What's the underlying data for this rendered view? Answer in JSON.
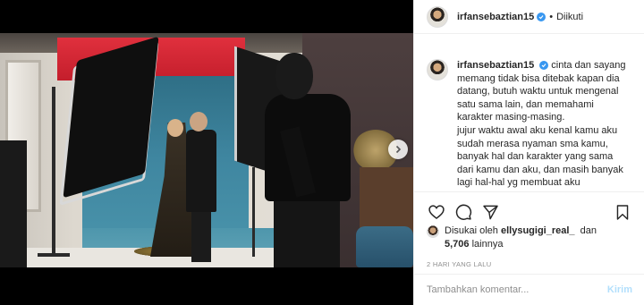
{
  "header": {
    "username": "irfansebaztian15",
    "separator": "•",
    "follow_status": "Diikuti"
  },
  "caption": {
    "username": "irfansebaztian15",
    "lines": [
      "cinta dan sayang",
      "memang tidak bisa ditebak kapan dia",
      "datang, butuh waktu untuk mengenal",
      "satu sama lain, dan memahami",
      "karakter masing-masing.",
      "jujur waktu awal aku kenal kamu aku",
      "sudah merasa nyaman sma kamu,",
      "banyak hal dan karakter yang sama",
      "dari kamu dan aku, dan masih banyak",
      "lagi hal-hal yg membuat aku"
    ]
  },
  "likes": {
    "prefix": "Disukai oleh",
    "user": "ellysugigi_real_",
    "connector": "dan",
    "count": "5,706",
    "suffix": "lainnya"
  },
  "timestamp": "2 HARI YANG LALU",
  "comment": {
    "placeholder": "Tambahkan komentar...",
    "post_label": "Kirim"
  },
  "carousel": {
    "total_items": 4,
    "active_index": 0
  },
  "colors": {
    "verified_badge": "#3897f0",
    "post_button_disabled": "#b2dffc",
    "meta_text": "#8e8e8e"
  },
  "icons": [
    "verified-icon",
    "heart-icon",
    "comment-icon",
    "share-icon",
    "bookmark-icon",
    "chevron-right-icon",
    "user-tag-icon"
  ]
}
